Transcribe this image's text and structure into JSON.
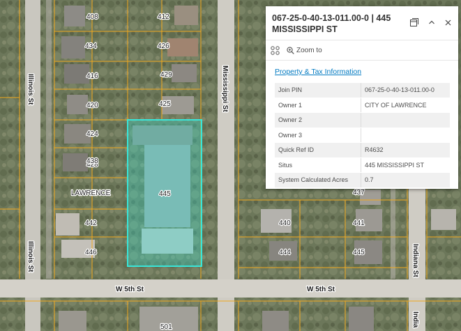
{
  "map": {
    "parcel_numbers": [
      "408",
      "412",
      "416",
      "420",
      "424",
      "428",
      "426",
      "425",
      "429",
      "445",
      "434",
      "438",
      "442",
      "446",
      "437",
      "440",
      "441",
      "444",
      "445",
      "501"
    ],
    "streets": {
      "illinois_north": "Illinois St",
      "illinois_south": "Illinois St",
      "mississippi": "Mississippi St",
      "w5th_west": "W 5th St",
      "w5th_east": "W 5th St",
      "indiana": "Indiana St",
      "indiana_bottom": "India"
    },
    "place_label": "LAWRENCE",
    "selection_color": "#38e6d9",
    "parcel_line_color": "#f2a91d"
  },
  "popup": {
    "title": "067-25-0-40-13-011.00-0 | 445 MISSISSIPPI ST",
    "zoom_to_label": "Zoom to",
    "link_label": "Property & Tax Information",
    "attributes": [
      {
        "key": "Join PIN",
        "value": "067-25-0-40-13-011.00-0"
      },
      {
        "key": "Owner 1",
        "value": "CITY OF LAWRENCE"
      },
      {
        "key": "Owner 2",
        "value": ""
      },
      {
        "key": "Owner 3",
        "value": ""
      },
      {
        "key": "Quick Ref ID",
        "value": "R4632"
      },
      {
        "key": "Situs",
        "value": "445 MISSISSIPPI ST"
      },
      {
        "key": "System Calculated Acres",
        "value": "0.7"
      }
    ],
    "icons": {
      "dock": "dock-icon",
      "collapse": "chevron-up-icon",
      "close": "close-icon",
      "actions": "features-icon",
      "zoom": "zoom-in-icon"
    }
  }
}
